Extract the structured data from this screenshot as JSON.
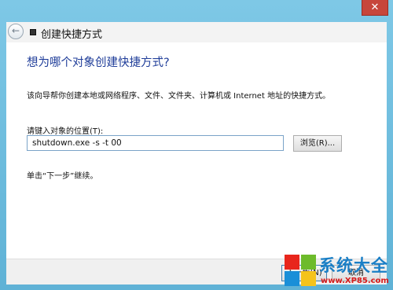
{
  "window": {
    "close_glyph": "✕"
  },
  "header": {
    "back_glyph": "←",
    "title": "创建快捷方式"
  },
  "content": {
    "main_instruction": "想为哪个对象创建快捷方式?",
    "description": "该向导帮你创建本地或网络程序、文件、文件夹、计算机或 Internet 地址的快捷方式。",
    "field_label": "请键入对象的位置(T):",
    "location_value": "shutdown.exe -s -t 00",
    "browse_label": "浏览(R)...",
    "hint": "单击“下一步”继续。"
  },
  "footer": {
    "next_label": "下一步(N)",
    "cancel_label": "取消"
  },
  "watermark": {
    "name": "系统大全",
    "url": "www.XP85.com",
    "logo_colors": [
      "#e8261c",
      "#6dbb2b",
      "#1a8fd8",
      "#f5c31c"
    ]
  }
}
